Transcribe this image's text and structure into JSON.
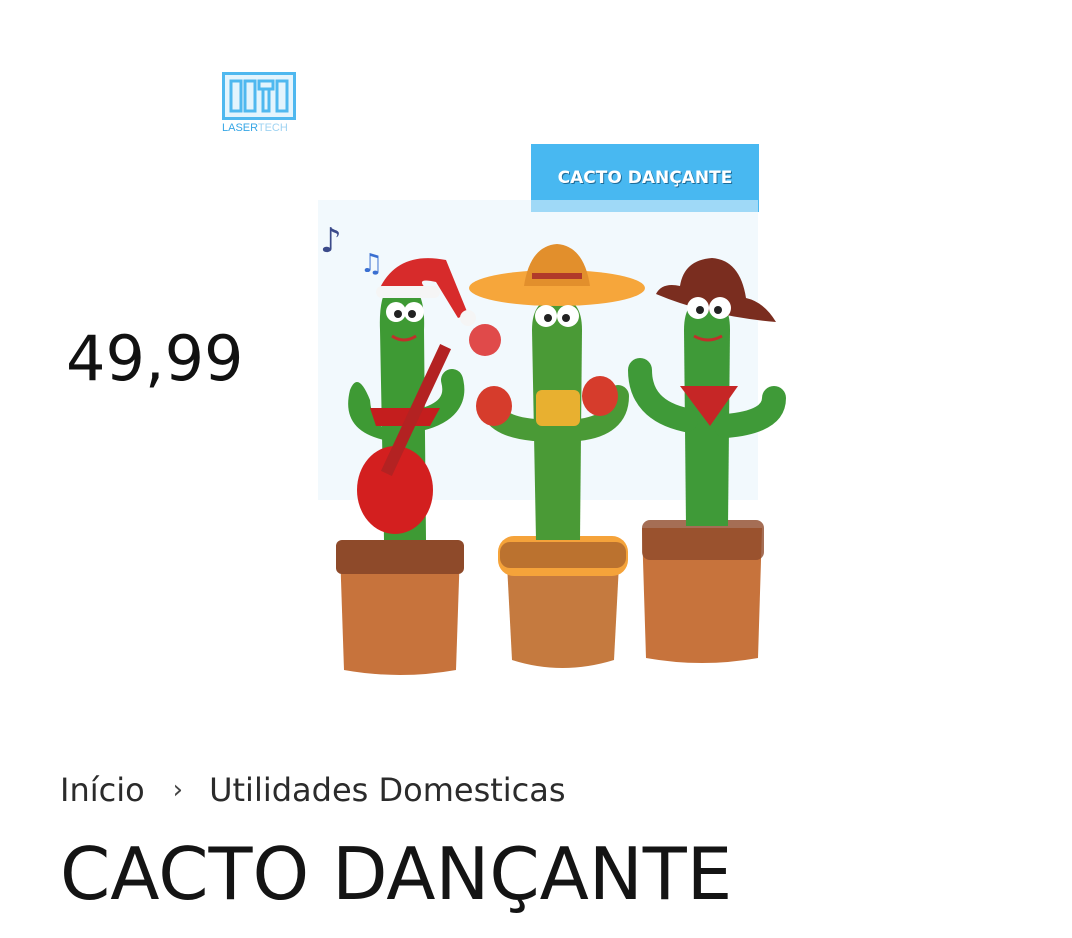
{
  "product": {
    "price": "49,99",
    "title": "CACTO DANÇANTE",
    "image": {
      "badge_text": "CACTO DANÇANTE",
      "logo_text_main": "LASER",
      "logo_text_light": "TECH",
      "logo_icon": "lasertech-logo-icon",
      "accent_color": "#48b8f1"
    }
  },
  "breadcrumb": {
    "home": "Início",
    "separator_icon": "chevron-right-icon",
    "separator_glyph": "›",
    "category": "Utilidades Domesticas"
  }
}
